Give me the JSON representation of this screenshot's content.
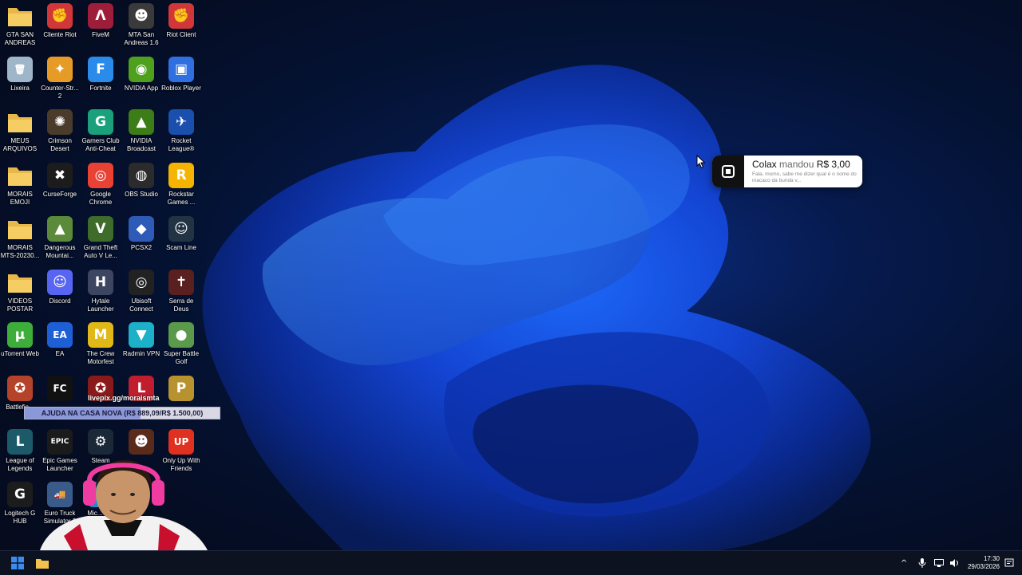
{
  "desktop": {
    "icons": [
      {
        "label": "GTA SAN ANDREAS",
        "icon": "folder-icon",
        "color": "#e8b74a",
        "glyph": ""
      },
      {
        "label": "Cliente Riot",
        "icon": "riot-icon",
        "color": "#d13639",
        "glyph": "✊"
      },
      {
        "label": "FiveM",
        "icon": "fivem-icon",
        "color": "#9e1e3a",
        "glyph": "Λ"
      },
      {
        "label": "MTA San Andreas 1.6",
        "icon": "mta-icon",
        "color": "#3a3a3a",
        "glyph": "☻"
      },
      {
        "label": "Riot Client",
        "icon": "riot-icon",
        "color": "#d13639",
        "glyph": "✊"
      },
      {
        "label": "Lixeira",
        "icon": "recycle-bin-icon",
        "color": "#9fb5c8",
        "glyph": "🗑"
      },
      {
        "label": "Counter-Str... 2",
        "icon": "counter-strike-icon",
        "color": "#e59b26",
        "glyph": "✦"
      },
      {
        "label": "Fortnite",
        "icon": "fortnite-icon",
        "color": "#2a8bea",
        "glyph": "F"
      },
      {
        "label": "NVIDIA App",
        "icon": "nvidia-icon",
        "color": "#4ea01d",
        "glyph": "◉"
      },
      {
        "label": "Roblox Player",
        "icon": "roblox-icon",
        "color": "#2f6fe0",
        "glyph": "▣"
      },
      {
        "label": "MEUS ARQUIVOS",
        "icon": "folder-icon",
        "color": "#e8b74a",
        "glyph": ""
      },
      {
        "label": "Crimson Desert",
        "icon": "crimson-desert-icon",
        "color": "#4a3b2a",
        "glyph": "✺"
      },
      {
        "label": "Gamers Club Anti-Cheat",
        "icon": "gamers-club-icon",
        "color": "#1aa07a",
        "glyph": "G"
      },
      {
        "label": "NVIDIA Broadcast",
        "icon": "nvidia-broadcast-icon",
        "color": "#3d7d18",
        "glyph": "▲"
      },
      {
        "label": "Rocket League®",
        "icon": "rocket-league-icon",
        "color": "#1a4fae",
        "glyph": "✈"
      },
      {
        "label": "MORAIS EMOJI",
        "icon": "folder-icon",
        "color": "#e8b74a",
        "glyph": ""
      },
      {
        "label": "CurseForge",
        "icon": "curseforge-icon",
        "color": "#1c1c1c",
        "glyph": "✖"
      },
      {
        "label": "Google Chrome",
        "icon": "chrome-icon",
        "color": "#e94235",
        "glyph": "◎"
      },
      {
        "label": "OBS Studio",
        "icon": "obs-icon",
        "color": "#2b2b2b",
        "glyph": "◍"
      },
      {
        "label": "Rockstar Games ...",
        "icon": "rockstar-icon",
        "color": "#f4b400",
        "glyph": "R"
      },
      {
        "label": "MORAIS MTS-20230...",
        "icon": "folder-icon",
        "color": "#e8b74a",
        "glyph": ""
      },
      {
        "label": "Dangerous Mountai...",
        "icon": "dangerous-mountain-icon",
        "color": "#5a8a3a",
        "glyph": "▲"
      },
      {
        "label": "Grand Theft Auto V Le...",
        "icon": "gta-v-icon",
        "color": "#3f6b2b",
        "glyph": "V"
      },
      {
        "label": "PCSX2",
        "icon": "pcsx2-icon",
        "color": "#2f5bb8",
        "glyph": "◆"
      },
      {
        "label": "Scam Line",
        "icon": "scam-line-icon",
        "color": "#223344",
        "glyph": "☺"
      },
      {
        "label": "VIDEOS POSTAR",
        "icon": "folder-icon",
        "color": "#e8b74a",
        "glyph": ""
      },
      {
        "label": "Discord",
        "icon": "discord-icon",
        "color": "#5865f2",
        "glyph": "☺"
      },
      {
        "label": "Hytale Launcher",
        "icon": "hytale-icon",
        "color": "#3c4660",
        "glyph": "H"
      },
      {
        "label": "Ubisoft Connect",
        "icon": "ubisoft-icon",
        "color": "#222",
        "glyph": "◎"
      },
      {
        "label": "Serra de Deus",
        "icon": "serra-de-deus-icon",
        "color": "#5a2020",
        "glyph": "✝"
      },
      {
        "label": "uTorrent Web",
        "icon": "utorrent-icon",
        "color": "#3dae3a",
        "glyph": "µ"
      },
      {
        "label": "EA",
        "icon": "ea-icon",
        "color": "#1f5fd6",
        "glyph": "EA"
      },
      {
        "label": "The Crew Motorfest",
        "icon": "the-crew-icon",
        "color": "#e0b818",
        "glyph": "M"
      },
      {
        "label": "Radmin VPN",
        "icon": "radmin-icon",
        "color": "#1cb0c9",
        "glyph": "▼"
      },
      {
        "label": "Super Battle Golf",
        "icon": "super-battle-golf-icon",
        "color": "#5a9a4a",
        "glyph": "●"
      },
      {
        "label": "Battlefie...",
        "icon": "battlefield-icon",
        "color": "#b5432a",
        "glyph": "✪"
      },
      {
        "label": "",
        "icon": "fc-icon",
        "color": "#111",
        "glyph": "FC"
      },
      {
        "label": "",
        "icon": "game-icon",
        "color": "#8a1a1a",
        "glyph": "✪"
      },
      {
        "label": "",
        "icon": "game-icon",
        "color": "#c01e2e",
        "glyph": "L"
      },
      {
        "label": "",
        "icon": "game-icon",
        "color": "#b8922e",
        "glyph": "P"
      },
      {
        "label": "League of Legends",
        "icon": "league-icon",
        "color": "#1c5a6a",
        "glyph": "L"
      },
      {
        "label": "Epic Games Launcher",
        "icon": "epic-icon",
        "color": "#1b1b1b",
        "glyph": "EPIC"
      },
      {
        "label": "Steam",
        "icon": "steam-icon",
        "color": "#1b2838",
        "glyph": "⚙"
      },
      {
        "label": "",
        "icon": "game-icon",
        "color": "#5a2a1a",
        "glyph": "☻"
      },
      {
        "label": "Only Up With Friends",
        "icon": "only-up-icon",
        "color": "#e03020",
        "glyph": "UP"
      },
      {
        "label": "Logitech G HUB",
        "icon": "logitech-icon",
        "color": "#1c1c1c",
        "glyph": "G"
      },
      {
        "label": "Euro Truck Simulator 2",
        "icon": "euro-truck-icon",
        "color": "#3a5a8a",
        "glyph": "🚚"
      },
      {
        "label": "Mic... E...",
        "icon": "edge-icon",
        "color": "#1c8ad8",
        "glyph": "e"
      }
    ]
  },
  "overlay": {
    "link_text": "livepix.gg/moraismta",
    "goal_text": "AJUDA NA CASA NOVA (R$ 889,09/R$ 1.500,00)",
    "goal_progress": 0.593
  },
  "notification": {
    "sender": "Colax",
    "action": "mandou",
    "amount": "R$ 3,00",
    "message": "Fala, momo, sabe me dizer qual é o nome do macaco da bunda v..."
  },
  "taskbar": {
    "time": "17:30",
    "date": "29/03/2026"
  },
  "colors": {
    "taskbar_bg": "#0d1220",
    "accent": "#3c8cf0"
  }
}
